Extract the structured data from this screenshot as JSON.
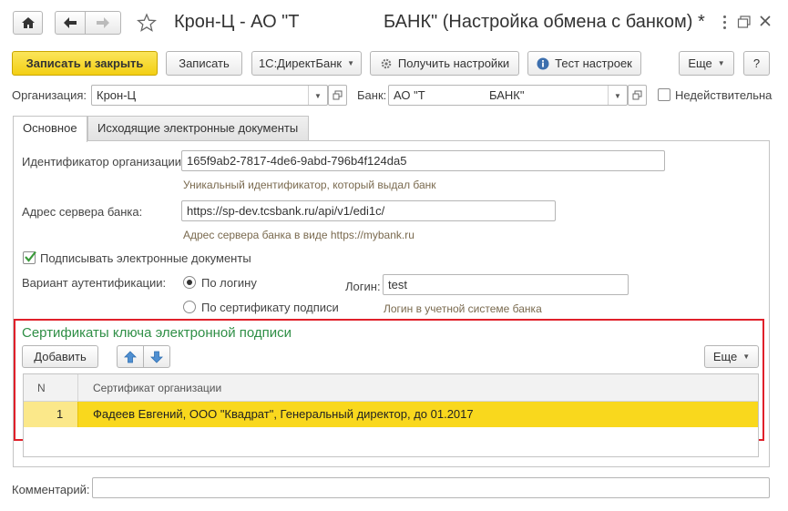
{
  "window": {
    "title_part1": "Крон-Ц - АО \"Т",
    "title_part2": "БАНК\" (Настройка обмена с банком) *"
  },
  "toolbar": {
    "save_close": "Записать и закрыть",
    "save": "Записать",
    "directbank": "1С:ДиректБанк",
    "get_settings": "Получить настройки",
    "test_settings": "Тест настроек",
    "more": "Еще",
    "help": "?"
  },
  "org": {
    "label": "Организация:",
    "value": "Крон-Ц"
  },
  "bank": {
    "label": "Банк:",
    "value_part1": "АО \"Т",
    "value_part2": "БАНК\""
  },
  "invalid_label": "Недействительна",
  "tabs": [
    {
      "label": "Основное"
    },
    {
      "label": "Исходящие электронные документы"
    }
  ],
  "org_id": {
    "label": "Идентификатор организации:",
    "value": "165f9ab2-7817-4de6-9abd-796b4f124da5",
    "hint": "Уникальный идентификатор, который выдал банк"
  },
  "server": {
    "label": "Адрес сервера банка:",
    "value": "https://sp-dev.tcsbank.ru/api/v1/edi1c/",
    "hint": "Адрес сервера банка в виде https://mybank.ru"
  },
  "sign_docs": {
    "label": "Подписывать электронные документы",
    "checked": true
  },
  "auth": {
    "label": "Вариант аутентификации:",
    "option_login": "По логину",
    "option_cert": "По сертификату подписи",
    "selected": "По логину"
  },
  "login": {
    "label": "Логин:",
    "value": "test",
    "hint": "Логин в учетной системе банка"
  },
  "certs": {
    "title": "Сертификаты ключа электронной подписи",
    "add": "Добавить",
    "more": "Еще",
    "columns": {
      "n": "N",
      "cert": "Сертификат организации"
    },
    "rows": [
      {
        "n": "1",
        "cert": "Фадеев Евгений, ООО \"Квадрат\", Генеральный директор, до 01.2017"
      }
    ]
  },
  "comment": {
    "label": "Комментарий:",
    "value": ""
  },
  "colors": {
    "primary_button": "#f3cf14",
    "selected_row": "#f9d81d",
    "section_title": "#2f8f46",
    "highlight_frame": "#e0202a"
  }
}
